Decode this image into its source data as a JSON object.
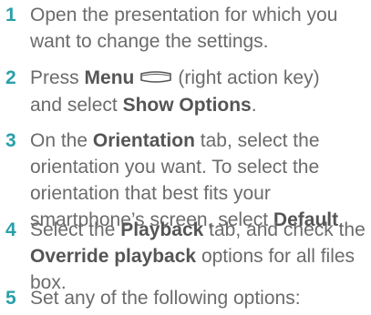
{
  "steps": [
    {
      "number": "1",
      "line1": "Open the presentation for which you",
      "line2": "want to change the settings."
    },
    {
      "number": "2",
      "press": "Press",
      "menu": "Menu",
      "action_key": "(right action key)",
      "and_select": "and select",
      "show_options": "Show Options",
      "period": "."
    },
    {
      "number": "3",
      "on_the": "On the",
      "orientation": "Orientation",
      "tab_select": "tab, select the",
      "line2": "orientation you want. To select the",
      "line3": "orientation that best fits your",
      "line4_pre": "smartphone’s screen, select",
      "default": "Default",
      "period": "."
    },
    {
      "number": "4",
      "select_the": "Select the",
      "playback": "Playback",
      "tab_check": "tab, and check the",
      "override": "Override playback",
      "options_rest": "options for all files",
      "box": "box."
    },
    {
      "number": "5",
      "line1": "Set any of the following options:"
    }
  ],
  "icons": {
    "action_key": "right-action-key-icon"
  },
  "colors": {
    "step_number": "#2a9fa8",
    "body_text": "#6b6b6b"
  }
}
